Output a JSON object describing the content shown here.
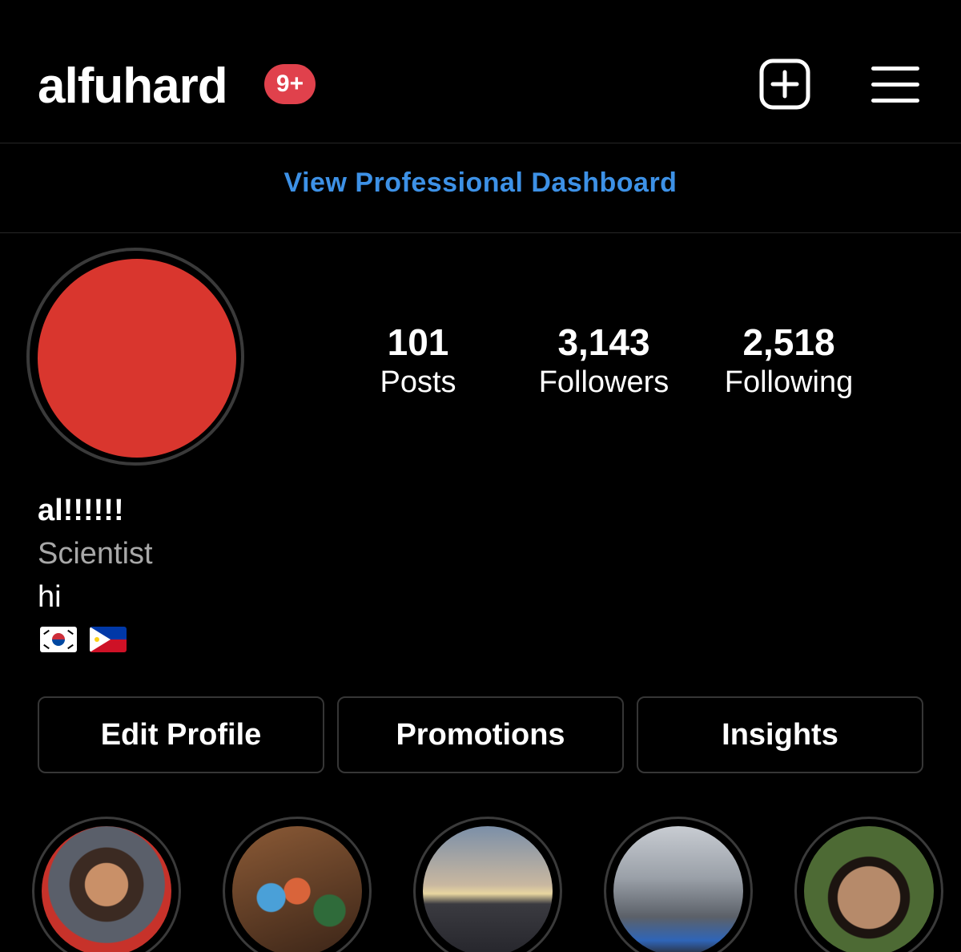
{
  "header": {
    "username": "alfuhard",
    "notification_badge": "9+",
    "new_post_icon": "plus-square-icon",
    "menu_icon": "hamburger-menu-icon"
  },
  "dashboard": {
    "link_label": "View Professional Dashboard",
    "accent_color": "#3d91e6"
  },
  "profile": {
    "avatar_color": "#d9362e",
    "stats": [
      {
        "value": "101",
        "label": "Posts"
      },
      {
        "value": "3,143",
        "label": "Followers"
      },
      {
        "value": "2,518",
        "label": "Following"
      }
    ],
    "display_name": "al!!!!!!",
    "category": "Scientist",
    "bio": "hi",
    "flags": [
      "south-korea-flag-icon",
      "philippines-flag-icon"
    ]
  },
  "actions": {
    "edit_profile": "Edit Profile",
    "promotions": "Promotions",
    "insights": "Insights"
  },
  "highlights": [
    {
      "icon": "highlight-selfie"
    },
    {
      "icon": "highlight-drinks"
    },
    {
      "icon": "highlight-beach-sunset"
    },
    {
      "icon": "highlight-subway"
    },
    {
      "icon": "highlight-portrait"
    }
  ]
}
